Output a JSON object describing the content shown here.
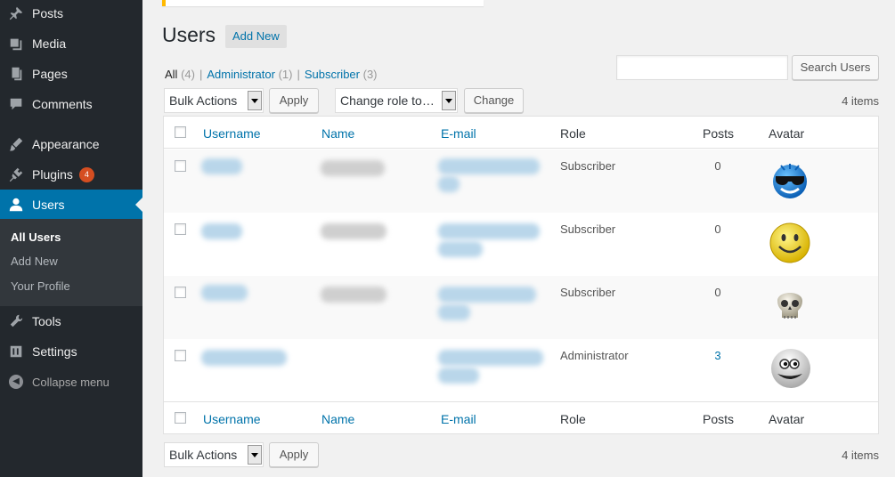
{
  "sidebar": {
    "items": [
      {
        "label": "Posts",
        "icon": "pin-icon"
      },
      {
        "label": "Media",
        "icon": "media-icon"
      },
      {
        "label": "Pages",
        "icon": "pages-icon"
      },
      {
        "label": "Comments",
        "icon": "comments-icon"
      },
      {
        "label": "Appearance",
        "icon": "appearance-icon"
      },
      {
        "label": "Plugins",
        "icon": "plugins-icon",
        "badge": "4"
      },
      {
        "label": "Users",
        "icon": "users-icon"
      },
      {
        "label": "Tools",
        "icon": "tools-icon"
      },
      {
        "label": "Settings",
        "icon": "settings-icon"
      }
    ],
    "submenu": [
      "All Users",
      "Add New",
      "Your Profile"
    ],
    "collapse_label": "Collapse menu"
  },
  "header": {
    "title": "Users",
    "add_new": "Add New"
  },
  "filters": {
    "all": {
      "label": "All",
      "count": "(4)"
    },
    "administrator": {
      "label": "Administrator",
      "count": "(1)"
    },
    "subscriber": {
      "label": "Subscriber",
      "count": "(3)"
    },
    "separator": "|"
  },
  "search": {
    "value": "",
    "button": "Search Users"
  },
  "toolbar": {
    "bulk_actions": "Bulk Actions",
    "apply": "Apply",
    "change_role": "Change role to…",
    "change": "Change",
    "items_count": "4 items"
  },
  "table": {
    "columns": [
      "Username",
      "Name",
      "E-mail",
      "Role",
      "Posts",
      "Avatar"
    ],
    "rows": [
      {
        "role": "Subscriber",
        "posts": "0",
        "avatar": "cool-smiley-avatar"
      },
      {
        "role": "Subscriber",
        "posts": "0",
        "avatar": "smiley-avatar"
      },
      {
        "role": "Subscriber",
        "posts": "0",
        "avatar": "skull-avatar"
      },
      {
        "role": "Administrator",
        "posts": "3",
        "avatar": "white-smiley-avatar"
      }
    ]
  },
  "colors": {
    "sidebar_bg": "#23282d",
    "accent": "#0073aa",
    "badge": "#d54e21",
    "notice": "#ffb900"
  }
}
